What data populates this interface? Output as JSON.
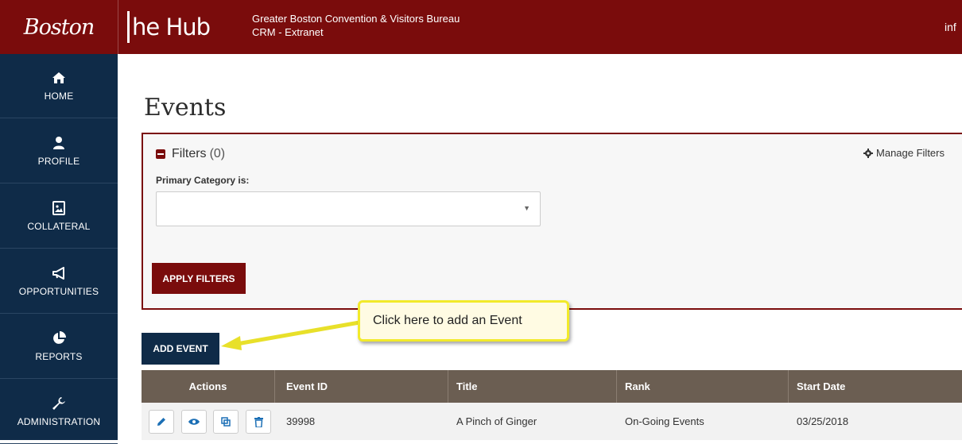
{
  "header": {
    "logo_boston": "Boston",
    "logo_hub": "he Hub",
    "org_name": "Greater Boston Convention & Visitors Bureau",
    "app_name": "CRM - Extranet",
    "user_fragment": "inf"
  },
  "sidebar": {
    "items": [
      {
        "label": "HOME",
        "icon": "home-icon"
      },
      {
        "label": "PROFILE",
        "icon": "user-icon"
      },
      {
        "label": "COLLATERAL",
        "icon": "image-file-icon"
      },
      {
        "label": "OPPORTUNITIES",
        "icon": "megaphone-icon"
      },
      {
        "label": "REPORTS",
        "icon": "pie-chart-icon"
      },
      {
        "label": "ADMINISTRATION",
        "icon": "wrench-icon"
      }
    ]
  },
  "main": {
    "title": "Events",
    "filters": {
      "label": "Filters",
      "count": "(0)",
      "manage_label": "Manage Filters",
      "category_label": "Primary Category is:",
      "category_value": "",
      "apply_label": "APPLY FILTERS"
    },
    "callout_text": "Click here to add an Event",
    "add_event_label": "ADD EVENT",
    "table": {
      "columns": [
        "Actions",
        "Event ID",
        "Title",
        "Rank",
        "Start Date"
      ],
      "rows": [
        {
          "event_id": "39998",
          "title": "A Pinch of Ginger",
          "rank": "On-Going Events",
          "start_date": "03/25/2018"
        }
      ]
    }
  },
  "colors": {
    "brand_red": "#7a0c0c",
    "nav_blue": "#0f2b48",
    "table_header": "#6b5e52",
    "callout_border": "#f2ea2a",
    "action_icon": "#1b6fb5"
  }
}
